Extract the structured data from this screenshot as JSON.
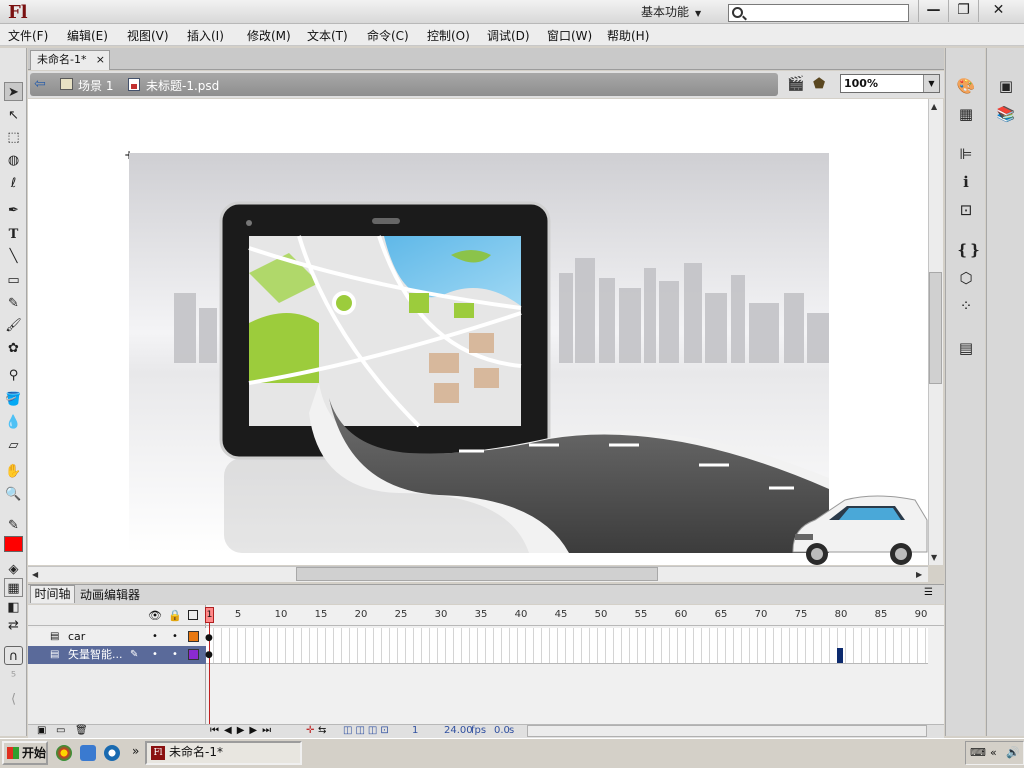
{
  "app": {
    "logo": "Fl",
    "workspace": "基本功能",
    "search_placeholder": ""
  },
  "window_controls": {
    "minimize": "—",
    "maximize": "❐",
    "close": "✕"
  },
  "menu": [
    "文件(F)",
    "编辑(E)",
    "视图(V)",
    "插入(I)",
    "修改(M)",
    "文本(T)",
    "命令(C)",
    "控制(O)",
    "调试(D)",
    "窗口(W)",
    "帮助(H)"
  ],
  "document": {
    "tab_title": "未命名-1*",
    "tab_close": "×",
    "scene": "场景 1",
    "symbol": "未标题-1.psd",
    "zoom": "100%"
  },
  "timeline": {
    "tabs": [
      "时间轴",
      "动画编辑器"
    ],
    "ruler": [
      "1",
      "5",
      "10",
      "15",
      "20",
      "25",
      "30",
      "35",
      "40",
      "45",
      "50",
      "55",
      "60",
      "65",
      "70",
      "75",
      "80",
      "85",
      "90"
    ],
    "layers": [
      {
        "name": "car",
        "color": "#e87810"
      },
      {
        "name": "矢量智能...",
        "color": "#8a2ad0"
      }
    ],
    "current_frame": "1",
    "fps": "24.00",
    "fps_unit": "fps",
    "time": "0.0",
    "time_unit": "s"
  },
  "taskbar": {
    "start": "开始",
    "window": "未命名-1*",
    "expand": "»"
  },
  "colors": {
    "accent": "#5a6a9a",
    "stroke": "#ff0000"
  }
}
